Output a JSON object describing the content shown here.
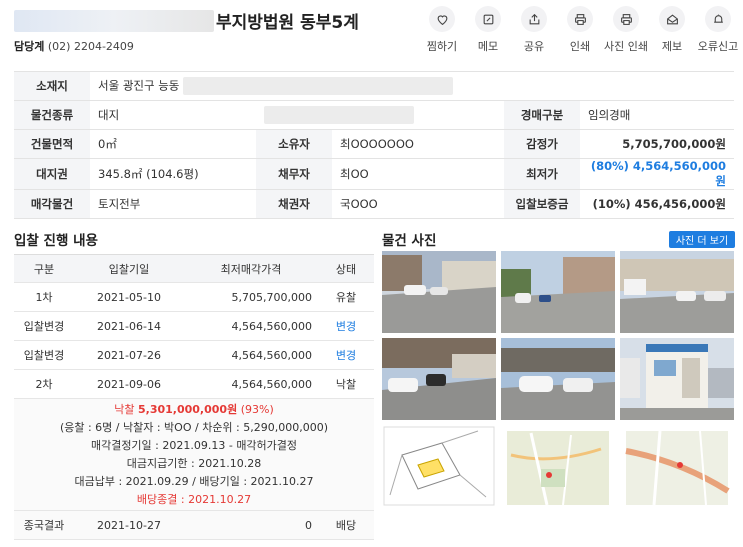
{
  "header": {
    "title": "부지방법원 동부5계",
    "contact_label": "담당계",
    "contact_phone": "(02) 2204-2409"
  },
  "actions": [
    {
      "label": "찜하기",
      "icon": "heart-icon"
    },
    {
      "label": "메모",
      "icon": "memo-icon"
    },
    {
      "label": "공유",
      "icon": "share-icon"
    },
    {
      "label": "인쇄",
      "icon": "print-icon"
    },
    {
      "label": "사진 인쇄",
      "icon": "photo-print-icon"
    },
    {
      "label": "제보",
      "icon": "report-icon"
    },
    {
      "label": "오류신고",
      "icon": "error-report-icon"
    }
  ],
  "info": {
    "location_label": "소재지",
    "location_value": "서울 광진구 능동",
    "type_label": "물건종류",
    "type_value": "대지",
    "auction_type_label": "경매구분",
    "auction_type_value": "임의경매",
    "building_area_label": "건물면적",
    "building_area_value": "0㎡",
    "owner_label": "소유자",
    "owner_value": "최OOOOOOO",
    "appraisal_label": "감정가",
    "appraisal_value": "5,705,700,000원",
    "land_right_label": "대지권",
    "land_right_value": "345.8㎡ (104.6평)",
    "debtor_label": "채무자",
    "debtor_value": "최OO",
    "minimum_label": "최저가",
    "minimum_value": "(80%) 4,564,560,000원",
    "sale_item_label": "매각물건",
    "sale_item_value": "토지전부",
    "creditor_label": "채권자",
    "creditor_value": "국OOO",
    "deposit_label": "입찰보증금",
    "deposit_value": "(10%) 456,456,000원"
  },
  "bidding": {
    "title": "입찰 진행 내용",
    "headers": [
      "구분",
      "입찰기일",
      "최저매각가격",
      "상태"
    ],
    "rows": [
      {
        "round": "1차",
        "date": "2021-05-10",
        "price": "5,705,700,000",
        "status": "유찰"
      },
      {
        "round": "입찰변경",
        "date": "2021-06-14",
        "price": "4,564,560,000",
        "status": "변경"
      },
      {
        "round": "입찰변경",
        "date": "2021-07-26",
        "price": "4,564,560,000",
        "status": "변경"
      },
      {
        "round": "2차",
        "date": "2021-09-06",
        "price": "4,564,560,000",
        "status": "낙찰"
      }
    ],
    "summary": {
      "win_label": "낙찰",
      "win_amount": "5,301,000,000원",
      "win_pct": "(93%)",
      "detail": "(응찰 : 6명 / 낙찰자 : 박OO / 차순위 : 5,290,000,000)",
      "decision": "매각결정기일 : 2021.09.13 - 매각허가결정",
      "deadline": "대금지급기한 : 2021.10.28",
      "payment": "대금납부 : 2021.09.29 / 배당기일 : 2021.10.27",
      "distribution_end": "배당종결 : 2021.10.27"
    },
    "final": {
      "label": "종국결과",
      "date": "2021-10-27",
      "amount": "0",
      "status": "배당"
    }
  },
  "photos": {
    "title": "물건 사진",
    "more_button": "사진 더 보기"
  },
  "colors": {
    "accent": "#1e7de0",
    "red": "#e53935",
    "header_bg": "#f4f5f7"
  }
}
